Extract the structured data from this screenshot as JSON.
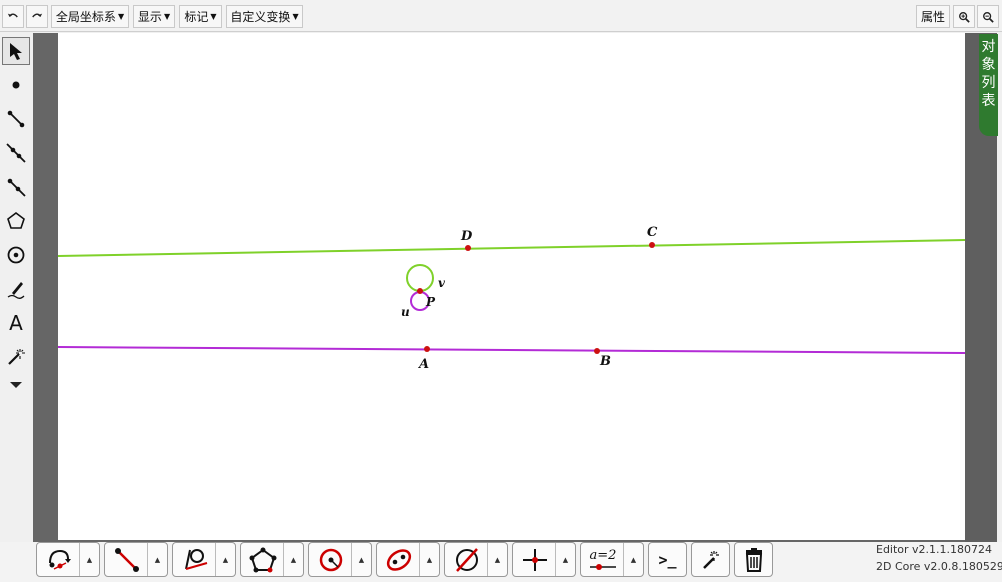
{
  "toolbar": {
    "undo_icon": "undo-icon",
    "redo_icon": "redo-icon",
    "menus": [
      "全局坐标系",
      "显示",
      "标记",
      "自定义变换"
    ],
    "properties_label": "属性",
    "zoom_in_icon": "zoom-in-icon",
    "zoom_out_icon": "zoom-out-icon"
  },
  "object_list": {
    "chars": [
      "对",
      "象",
      "列",
      "表"
    ]
  },
  "left_tools": [
    {
      "name": "select-tool",
      "icon": "arrow-pointer-icon"
    },
    {
      "name": "point-tool",
      "icon": "dot-icon"
    },
    {
      "name": "segment-tool",
      "icon": "segment-icon"
    },
    {
      "name": "line-tool",
      "icon": "line-icon"
    },
    {
      "name": "ray-tool",
      "icon": "ray-icon"
    },
    {
      "name": "polygon-tool",
      "icon": "pentagon-icon"
    },
    {
      "name": "circle-tool",
      "icon": "circle-icon"
    },
    {
      "name": "pen-tool",
      "icon": "pen-icon"
    },
    {
      "name": "text-tool",
      "label": "A"
    },
    {
      "name": "wand-tool",
      "icon": "magic-wand-icon"
    },
    {
      "name": "more-tools",
      "icon": "triangle-down-icon"
    }
  ],
  "geometry": {
    "points": [
      {
        "label": "D"
      },
      {
        "label": "C"
      },
      {
        "label": "A"
      },
      {
        "label": "B"
      },
      {
        "label": "P"
      }
    ],
    "circle_labels": [
      "v",
      "u"
    ],
    "colors": {
      "line_dc": "#7fd12a",
      "line_ab": "#b32bd6",
      "circle_v": "#7fd12a",
      "circle_u": "#b32bd6",
      "point": "#cc1111"
    }
  },
  "bottom_groups": [
    {
      "name": "transform-tools",
      "icon": "rotate-point-icon"
    },
    {
      "name": "segment-tools",
      "icon": "segment-red-icon"
    },
    {
      "name": "angle-tools",
      "icon": "angle-circle-icon"
    },
    {
      "name": "polygon-tools",
      "icon": "polygon-icon"
    },
    {
      "name": "circle-tools",
      "icon": "circle-point-icon"
    },
    {
      "name": "conic-tools",
      "icon": "ellipse-icon"
    },
    {
      "name": "construct-tools",
      "icon": "circle-slash-icon"
    },
    {
      "name": "coordinate-tools",
      "icon": "axes-point-icon"
    },
    {
      "name": "parameter-tools",
      "label": "a=2"
    }
  ],
  "bottom_singles": [
    {
      "name": "command-button",
      "label": ">_"
    },
    {
      "name": "magic-button",
      "icon": "magic-wand-icon"
    },
    {
      "name": "delete-button",
      "icon": "trash-icon"
    }
  ],
  "version": {
    "editor": "Editor v2.1.1.180724",
    "core": "2D Core v2.0.8.180529"
  }
}
